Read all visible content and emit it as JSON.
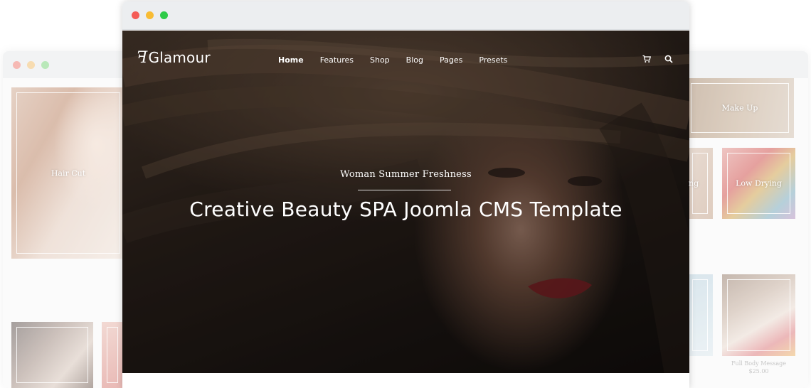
{
  "back_window": {
    "tiles": {
      "hair_cut": "Hair Cut",
      "make_up": "Make Up",
      "hair_partial": "ng",
      "low_drying": "Low Drying",
      "full_body_title": "Full Body Message",
      "full_body_price": "$25.00"
    }
  },
  "front_window": {
    "nav": {
      "logo": "Glamour",
      "logo_mark": "ꟻ",
      "items": [
        "Home",
        "Features",
        "Shop",
        "Blog",
        "Pages",
        "Presets"
      ],
      "cart_icon": "cart-icon",
      "search_icon": "search-icon"
    },
    "hero": {
      "subtitle": "Woman Summer Freshness",
      "title": "Creative Beauty SPA Joomla CMS Template"
    }
  },
  "colors": {
    "dot_red": "#f45c56",
    "dot_yellow": "#f8bc34",
    "dot_green": "#2ecb48"
  }
}
